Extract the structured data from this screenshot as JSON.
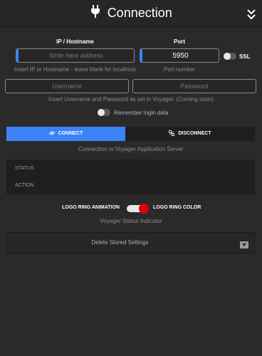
{
  "header": {
    "title": "Connection",
    "plug_icon": "plug-icon",
    "collapse_icon": "double-chevron-down-icon"
  },
  "host": {
    "label": "IP / Hostname",
    "placeholder": "Write here address",
    "value": "",
    "hint": "Insert IP or Hostname - leave blank for localhost"
  },
  "port": {
    "label": "Port",
    "value": "5950",
    "hint": "Port number"
  },
  "ssl": {
    "label": "SSL",
    "enabled": false
  },
  "credentials": {
    "username_placeholder": "Username",
    "password_placeholder": "Password",
    "hint": "Insert Username and Password as set in Voyager. (Coming soon)"
  },
  "remember": {
    "label": "Remember login data",
    "enabled": false
  },
  "buttons": {
    "connect": "CONNECT",
    "disconnect": "DISCONNECT",
    "connect_icon": "link-icon",
    "disconnect_icon": "unlink-icon"
  },
  "connection_hint": "Connection to Voyager Application Server",
  "status": {
    "status_label": "STATUS",
    "action_label": "ACTION"
  },
  "indicator": {
    "left_label": "LOGO RING ANIMATION",
    "right_label": "LOGO RING COLOR",
    "hint": "Voyager Status Indicator",
    "toggle_on": true
  },
  "settings": {
    "delete_label": "Delete Stored Settings",
    "dropdown_icon": "caret-down-icon"
  },
  "colors": {
    "accent": "#3b82f6",
    "background": "#2a2a2a",
    "header": "#262626",
    "panel": "#1f1f1f",
    "toggle_knob_red": "#e0000f"
  }
}
